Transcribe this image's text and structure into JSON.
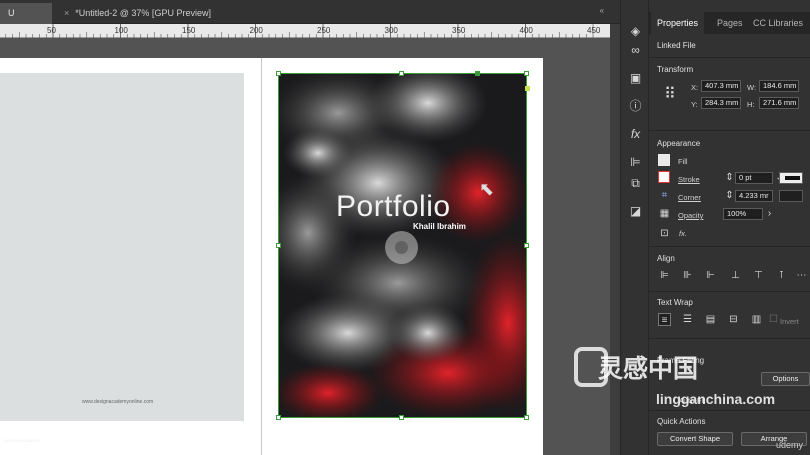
{
  "tabs": [
    {
      "label": "U Preview]"
    },
    {
      "label": "*Untitled-2 @ 37% [GPU Preview]",
      "close": "×"
    }
  ],
  "tabbar": {
    "collapse": "«"
  },
  "ruler": {
    "ticks": [
      "50",
      "100",
      "150",
      "200",
      "250",
      "300",
      "350",
      "400",
      "450"
    ]
  },
  "document": {
    "title": "Portfolio",
    "subtitle": "Khalil Ibrahim",
    "left_url": "www.designacademyonline.com",
    "corner_mark": "DESIGN ACADEMY"
  },
  "panel": {
    "tabs": [
      "Properties",
      "Pages",
      "CC Libraries"
    ],
    "linked_file": "Linked File",
    "transform": {
      "heading": "Transform",
      "x_label": "X:",
      "x_value": "407.3 mm",
      "y_label": "Y:",
      "y_value": "284.3 mm",
      "w_label": "W:",
      "w_value": "184.6 mm",
      "h_label": "H:",
      "h_value": "271.6 mm"
    },
    "appearance": {
      "heading": "Appearance",
      "fill": "Fill",
      "stroke": "Stroke",
      "stroke_value": "0 pt",
      "corner": "Corner",
      "corner_value": "4.233 mr",
      "opacity": "Opacity",
      "opacity_value": "100%",
      "fx": "fx."
    },
    "align": {
      "heading": "Align"
    },
    "text_wrap": {
      "heading": "Text Wrap",
      "invert": "Invert"
    },
    "frame_fitting": {
      "heading": "Frame Fitting",
      "options": "Options",
      "auto_fit": "Auto-Fit"
    },
    "quick_actions": {
      "heading": "Quick Actions",
      "convert_shape": "Convert Shape",
      "arrange": "Arrange"
    }
  },
  "watermark": {
    "text": "灵感中国",
    "url": "lingganchina.com",
    "udemy": "udemy"
  },
  "colors": {
    "accent_green": "#3c9c3c",
    "panel_bg": "#323232",
    "stroke_red": "#d33"
  }
}
